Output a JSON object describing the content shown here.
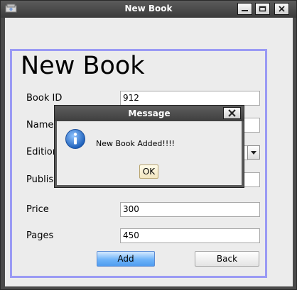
{
  "window": {
    "title": "New Book",
    "controls": [
      "minimize",
      "maximize",
      "close"
    ]
  },
  "form": {
    "heading": "New Book",
    "fields": [
      {
        "label": "Book ID",
        "value": "912"
      },
      {
        "label": "Name",
        "value": ""
      },
      {
        "label": "Edition",
        "value": ""
      },
      {
        "label": "Publish",
        "value": ""
      },
      {
        "label": "Price",
        "value": "300"
      },
      {
        "label": "Pages",
        "value": "450"
      }
    ],
    "add_label": "Add",
    "back_label": "Back"
  },
  "dialog": {
    "title": "Message",
    "message": "New Book Added!!!!",
    "ok_label": "OK",
    "icon": "info-icon"
  },
  "colors": {
    "group_border": "#9a9af4",
    "add_button": "#6fb4f9"
  }
}
